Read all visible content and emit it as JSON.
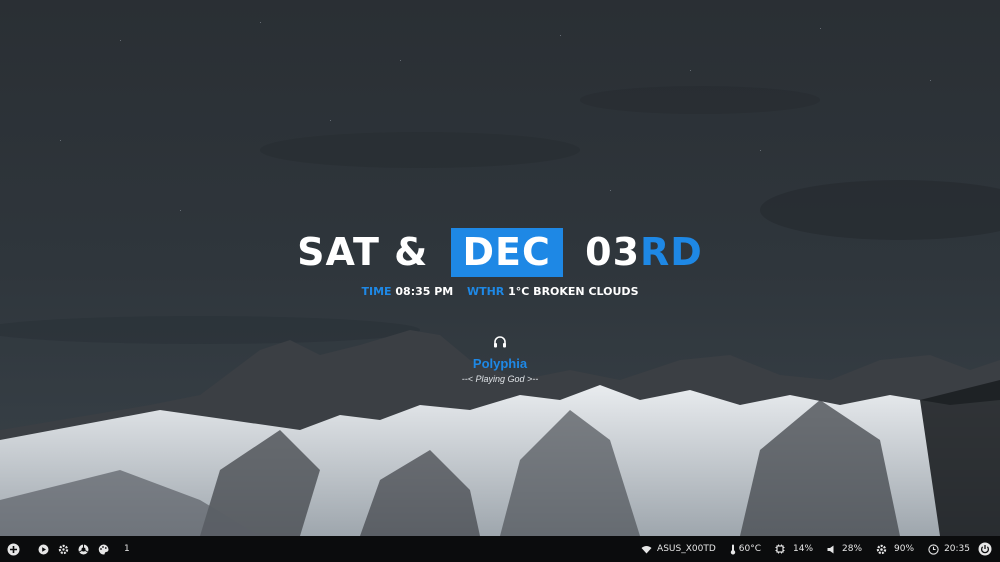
{
  "clock": {
    "day": "SAT",
    "amp": "&",
    "month": "DEC",
    "date": "03",
    "suffix": "RD"
  },
  "info": {
    "time_label": "TIME",
    "time_value": "08:35 PM",
    "weather_label": "WTHR",
    "weather_value": "1°C BROKEN CLOUDS"
  },
  "music": {
    "icon": "headphones-icon",
    "artist": "Polyphia",
    "song": "--< Playing God >--"
  },
  "colors": {
    "accent": "#1e88e5",
    "bar_bg": "#0b0c0d",
    "text": "#ffffff"
  },
  "taskbar": {
    "left": {
      "launcher_icon": "plus-circle-icon",
      "play_icon": "play-icon",
      "settings_icon": "gear-icon",
      "browser_icon": "chrome-icon",
      "palette_icon": "palette-icon",
      "workspace": "1"
    },
    "right": {
      "wifi": "ASUS_X00TD",
      "temperature": "60°C",
      "cpu": "14%",
      "volume": "28%",
      "brightness": "90%",
      "clock": "20:35",
      "power_icon": "power-icon"
    }
  }
}
